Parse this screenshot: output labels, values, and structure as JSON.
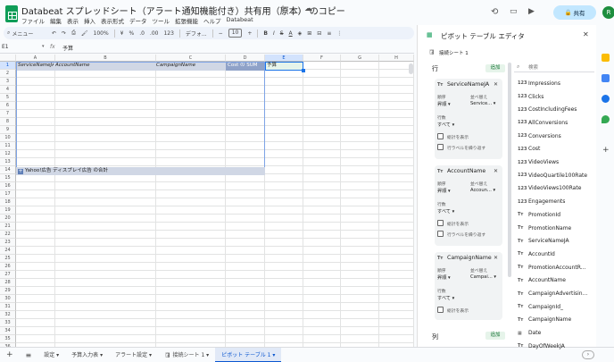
{
  "app": {
    "title": "Databeat スプレッドシート（アラート通知機能付き）共有用（原本）  のコピー",
    "menu": [
      "ファイル",
      "編集",
      "表示",
      "挿入",
      "表示形式",
      "データ",
      "ツール",
      "拡張機能",
      "ヘルプ",
      "Databeat"
    ],
    "share_label": "共有",
    "avatar_letter": "R"
  },
  "toolbar": {
    "search_label": "メニュー",
    "zoom": "100%",
    "currency": "¥",
    "percent": "%",
    "decimal_dec": ".0",
    "decimal_inc": ".00",
    "format_123": "123",
    "font": "デフォ...",
    "font_size": "10"
  },
  "formula_bar": {
    "cell_ref": "E1",
    "fx": "fx",
    "value": "予算"
  },
  "grid": {
    "columns": [
      "A",
      "B",
      "C",
      "D",
      "E",
      "F",
      "G",
      "H"
    ],
    "rows": [
      "1",
      "2",
      "3",
      "4",
      "5",
      "6",
      "7",
      "8",
      "9",
      "10",
      "11",
      "12",
      "13",
      "14",
      "15",
      "16",
      "17",
      "18",
      "19",
      "20",
      "21",
      "22",
      "23",
      "24",
      "25",
      "26",
      "27",
      "28",
      "29",
      "30",
      "31",
      "32",
      "33",
      "34",
      "35",
      "36"
    ],
    "row1": [
      "ServiceNameJA",
      "AccountName",
      "CampaignName",
      "Cost の SUM",
      "予算"
    ],
    "row7": "Yahoo!広告 ディスプレイ広告 の合計"
  },
  "sheets": {
    "add": "+",
    "list_icon": "≡",
    "tabs": [
      {
        "label": "設定 ▾"
      },
      {
        "label": "予算入力表 ▾"
      },
      {
        "label": "アラート設定 ▾"
      },
      {
        "label": "接続シート 1 ▾"
      },
      {
        "label": "ピボット テーブル 1 ▾"
      }
    ]
  },
  "pivot": {
    "title": "ピボット テーブル エディタ",
    "source": "接続シート 1",
    "rows_label": "行",
    "add_label": "追加",
    "columns_label": "列",
    "search_placeholder": "検索",
    "cards": [
      {
        "name": "ServiceNameJA",
        "order_label": "順序",
        "sort_label": "並べ替え",
        "order": "昇順",
        "sort": "Service...",
        "col_label": "行数",
        "col_value": "すべて",
        "total": "総計を表示",
        "repeat": "行ラベルを繰り返す"
      },
      {
        "name": "AccountName",
        "order_label": "順序",
        "sort_label": "並べ替え",
        "order": "昇順",
        "sort": "Accoun...",
        "col_label": "行数",
        "col_value": "すべて",
        "total": "総計を表示",
        "repeat": "行ラベルを繰り返す"
      },
      {
        "name": "CampaignName",
        "order_label": "順序",
        "sort_label": "並べ替え",
        "order": "昇順",
        "sort": "Campai...",
        "col_label": "行数",
        "col_value": "すべて",
        "total": "総計を表示",
        "repeat": ""
      }
    ],
    "fields": [
      {
        "type": "123",
        "name": "Impressions"
      },
      {
        "type": "123",
        "name": "Clicks"
      },
      {
        "type": "123",
        "name": "CostIncludingFees"
      },
      {
        "type": "123",
        "name": "AllConversions"
      },
      {
        "type": "123",
        "name": "Conversions"
      },
      {
        "type": "123",
        "name": "Cost"
      },
      {
        "type": "123",
        "name": "VideoViews"
      },
      {
        "type": "123",
        "name": "VideoQuartile100Rate"
      },
      {
        "type": "123",
        "name": "VideoViews100Rate"
      },
      {
        "type": "123",
        "name": "Engagements"
      },
      {
        "type": "Tт",
        "name": "PromotionId"
      },
      {
        "type": "Tт",
        "name": "PromotionName"
      },
      {
        "type": "Tт",
        "name": "ServiceNameJA"
      },
      {
        "type": "Tт",
        "name": "AccountId"
      },
      {
        "type": "Tт",
        "name": "PromotionAccountR..."
      },
      {
        "type": "Tт",
        "name": "AccountName"
      },
      {
        "type": "Tт",
        "name": "CampaignAdvertisin..."
      },
      {
        "type": "Tт",
        "name": "CampaignId_"
      },
      {
        "type": "Tт",
        "name": "CampaignName"
      },
      {
        "type": "▦",
        "name": "Date"
      },
      {
        "type": "Tт",
        "name": "DayOfWeekJA"
      }
    ]
  },
  "colors": {
    "accent": "#0b57d0",
    "selection": "#1a73e8",
    "header_bg": "#d0d7e5",
    "green": "#0f9d58"
  }
}
